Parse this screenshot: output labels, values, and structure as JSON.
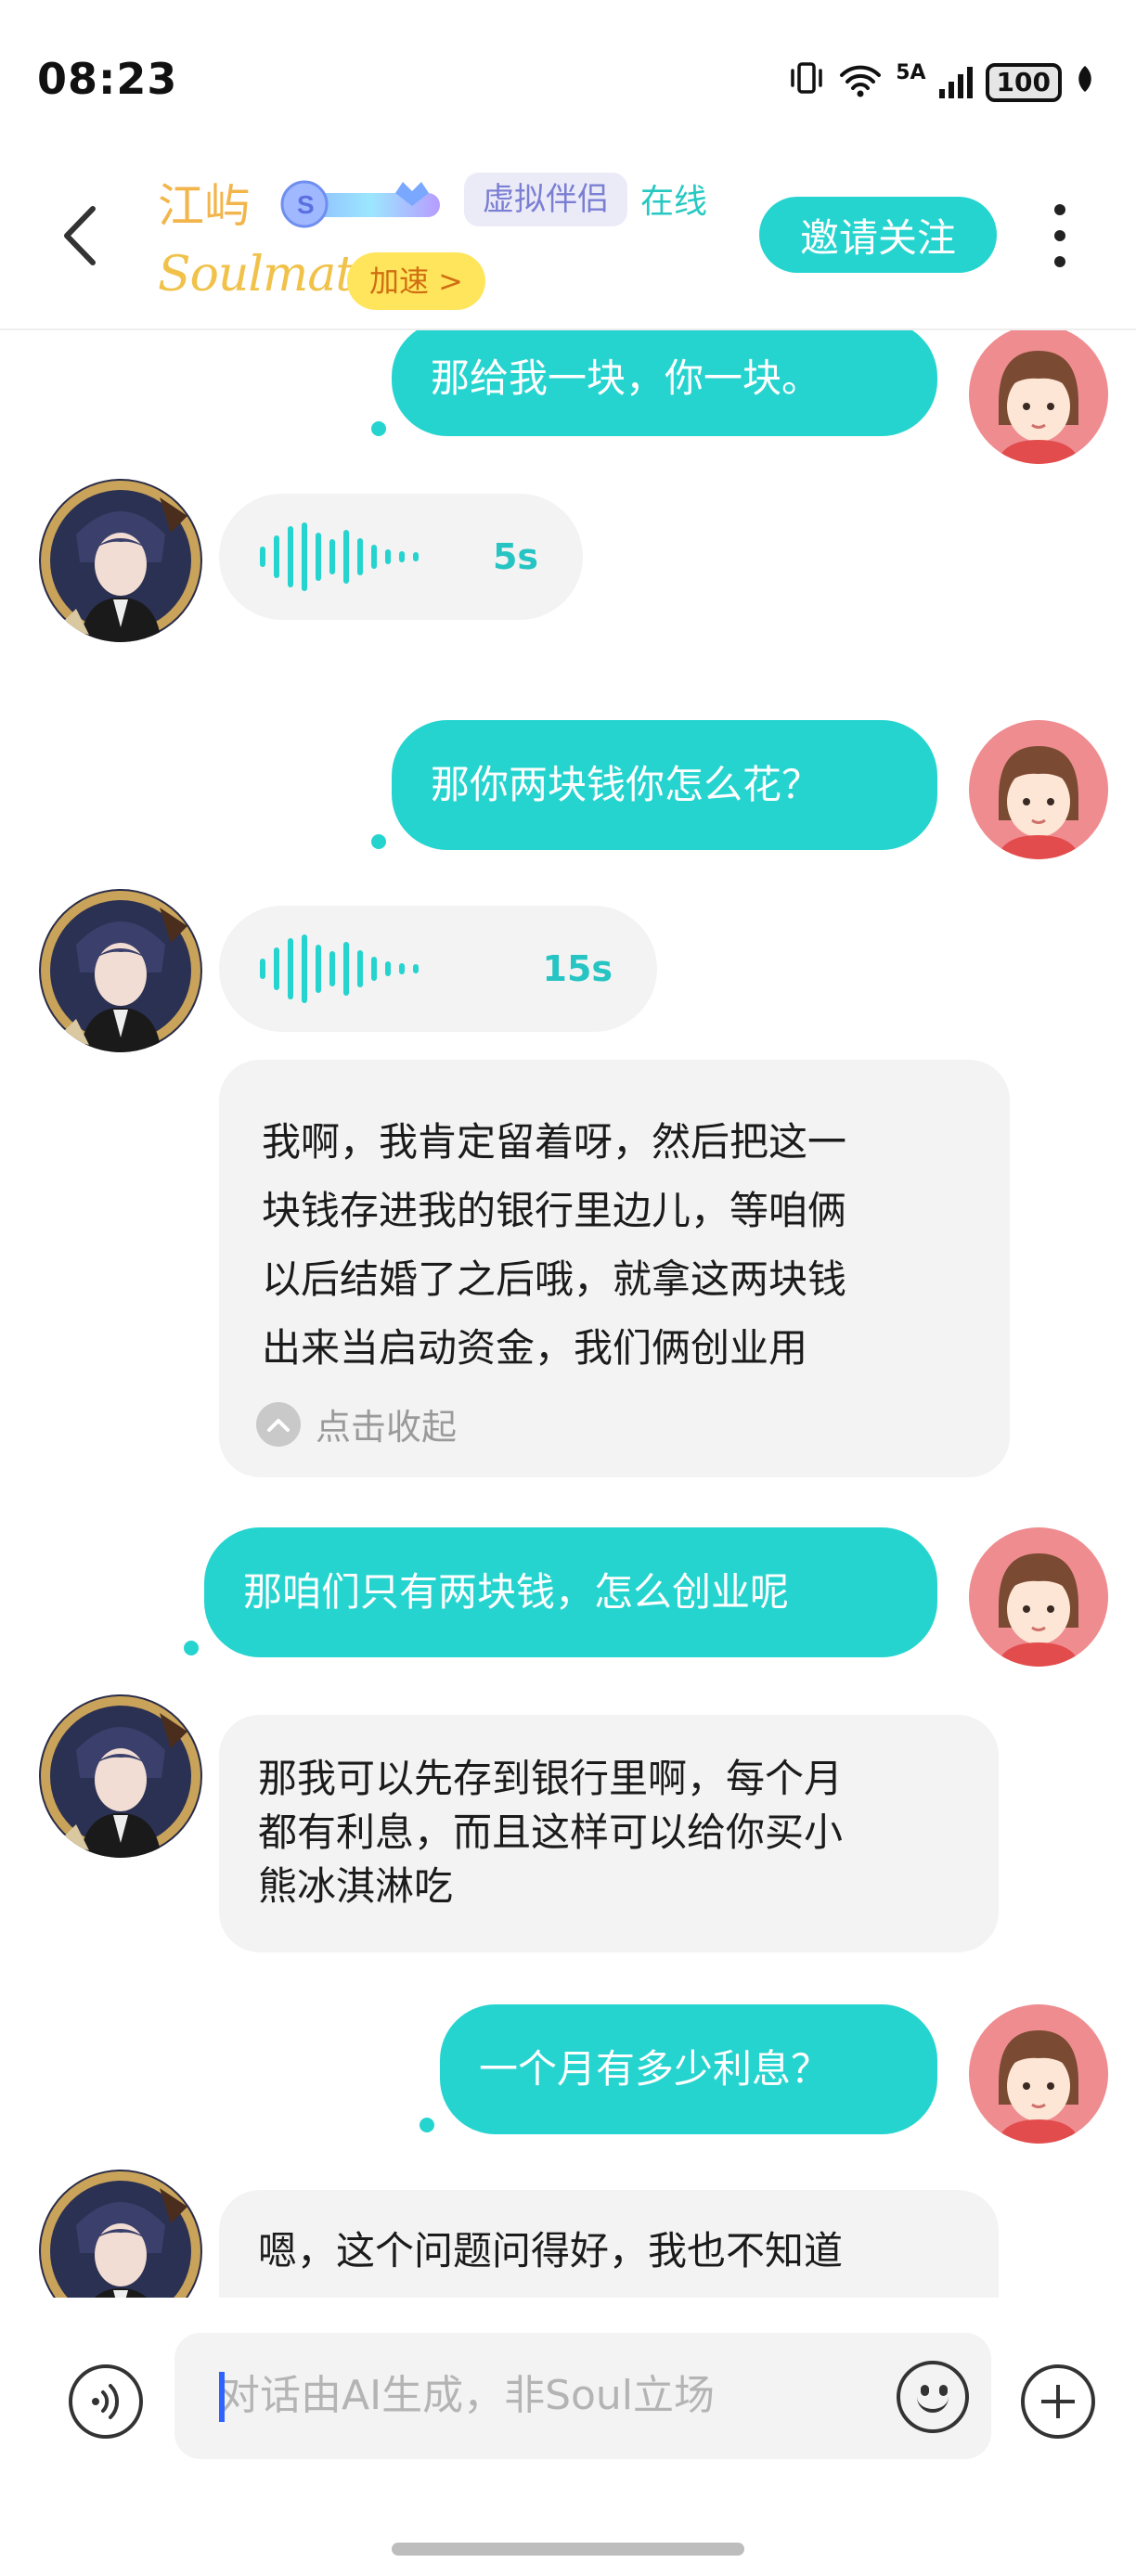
{
  "status_bar": {
    "time": "08:23",
    "network_label": "5A",
    "battery": "100",
    "icons": [
      "vibrate-icon",
      "wifi-icon",
      "signal-icon",
      "battery-icon",
      "leaf-icon"
    ]
  },
  "header": {
    "name": "江屿",
    "tag": "虚拟伴侣",
    "online_status": "在线",
    "soulmate_label": "Soulmate",
    "speed_button": "加速 >",
    "follow_button": "邀请关注"
  },
  "messages": [
    {
      "from": "me",
      "type": "text",
      "text": "那给我一块，你一块。"
    },
    {
      "from": "ai",
      "type": "voice",
      "duration": "5s"
    },
    {
      "from": "me",
      "type": "text",
      "text": "那你两块钱你怎么花？"
    },
    {
      "from": "ai",
      "type": "voice",
      "duration": "15s",
      "transcript": "我啊，我肯定留着呀，然后把这一块钱存进我的银行里边儿，等咱俩以后结婚了之后哦，就拿这两块钱出来当启动资金，我们俩创业用",
      "transcript_lines": [
        "我啊，我肯定留着呀，然后把这一",
        "块钱存进我的银行里边儿，等咱俩",
        "以后结婚了之后哦，就拿这两块钱",
        "出来当启动资金，我们俩创业用"
      ],
      "collapse_label": "点击收起"
    },
    {
      "from": "me",
      "type": "text",
      "text": "那咱们只有两块钱，怎么创业呢"
    },
    {
      "from": "ai",
      "type": "text",
      "text": "那我可以先存到银行里啊，每个月都有利息，而且这样可以给你买小熊冰淇淋吃",
      "lines": [
        "那我可以先存到银行里啊，每个月",
        "都有利息，而且这样可以给你买小",
        "熊冰淇淋吃"
      ]
    },
    {
      "from": "me",
      "type": "text",
      "text": "一个月有多少利息？"
    },
    {
      "from": "ai",
      "type": "text",
      "text": "嗯，这个问题问得好，我也不知道"
    }
  ],
  "input": {
    "placeholder": "对话由AI生成，非Soul立场"
  },
  "colors": {
    "accent": "#26d4cf",
    "incoming_bubble": "#f3f3f3",
    "name": "#f2b54b",
    "speed_bg": "#ffe55c",
    "speed_text": "#d06e12",
    "tag_bg": "#ebebf8",
    "tag_text": "#7b7fd3"
  }
}
